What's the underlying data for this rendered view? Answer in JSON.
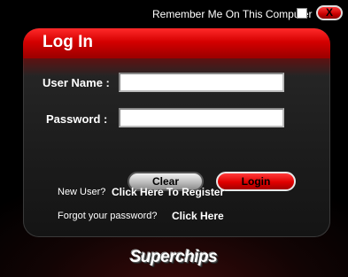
{
  "topbar": {
    "remember_label": "Remember Me On This Computer",
    "remember_checked": false,
    "close_label": "X"
  },
  "login": {
    "title": "Log In",
    "username_label": "User Name :",
    "username_value": "",
    "password_label": "Password :",
    "password_value": "",
    "clear_label": "Clear",
    "login_label": "Login"
  },
  "register": {
    "prompt": "New User?",
    "link": "Click Here To Register"
  },
  "forgot": {
    "prompt": "Forgot your password?",
    "link": "Click Here"
  },
  "brand": {
    "logo_text": "Superchips"
  },
  "colors": {
    "accent_red": "#d40000",
    "background": "#000000"
  }
}
